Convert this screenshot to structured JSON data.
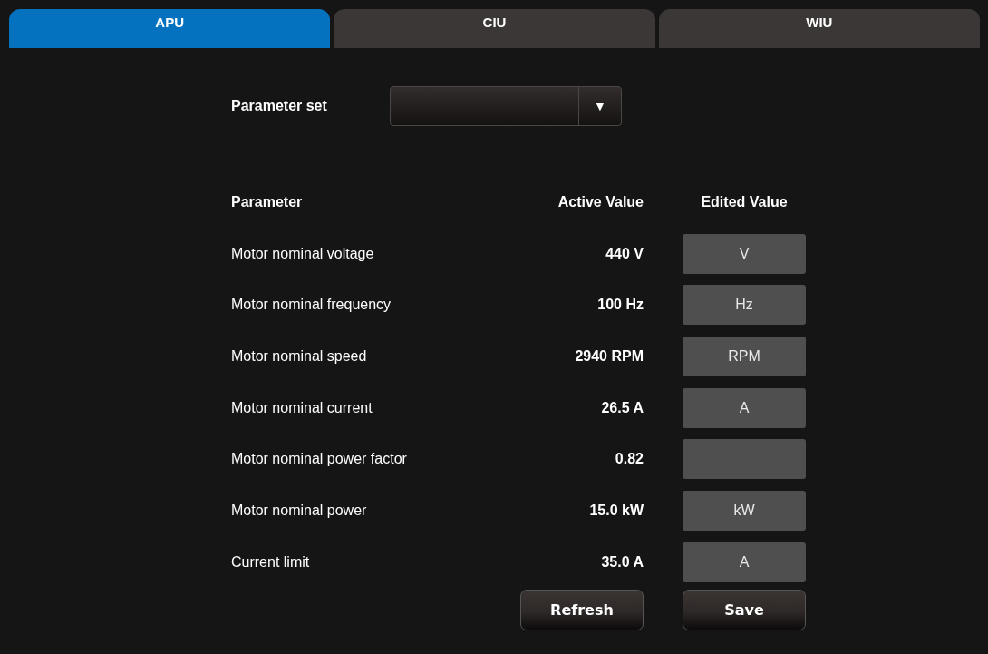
{
  "tabs": [
    {
      "label": "APU",
      "selected": true
    },
    {
      "label": "CIU",
      "selected": false
    },
    {
      "label": "WIU",
      "selected": false
    }
  ],
  "parameter_set": {
    "label": "Parameter set",
    "dropdown_arrow": "▼"
  },
  "table": {
    "columns": [
      "Parameter",
      "Active Value",
      "Edited Value"
    ],
    "rows": [
      {
        "name": "Motor nominal voltage",
        "active_value": "440 V",
        "placeholder": "V"
      },
      {
        "name": "Motor nominal frequency",
        "active_value": "100 Hz",
        "placeholder": "Hz"
      },
      {
        "name": "Motor nominal speed",
        "active_value": "2940 RPM",
        "placeholder": "RPM"
      },
      {
        "name": "Motor nominal current",
        "active_value": "26.5 A",
        "placeholder": "A"
      },
      {
        "name": "Motor nominal power factor",
        "active_value": "0.82"
      },
      {
        "name": "Motor nominal power",
        "active_value": "15.0 kW",
        "placeholder": "kW"
      },
      {
        "name": "Current limit",
        "active_value": "35.0 A",
        "placeholder": "A"
      }
    ]
  },
  "buttons": [
    "Refresh",
    "Save"
  ]
}
